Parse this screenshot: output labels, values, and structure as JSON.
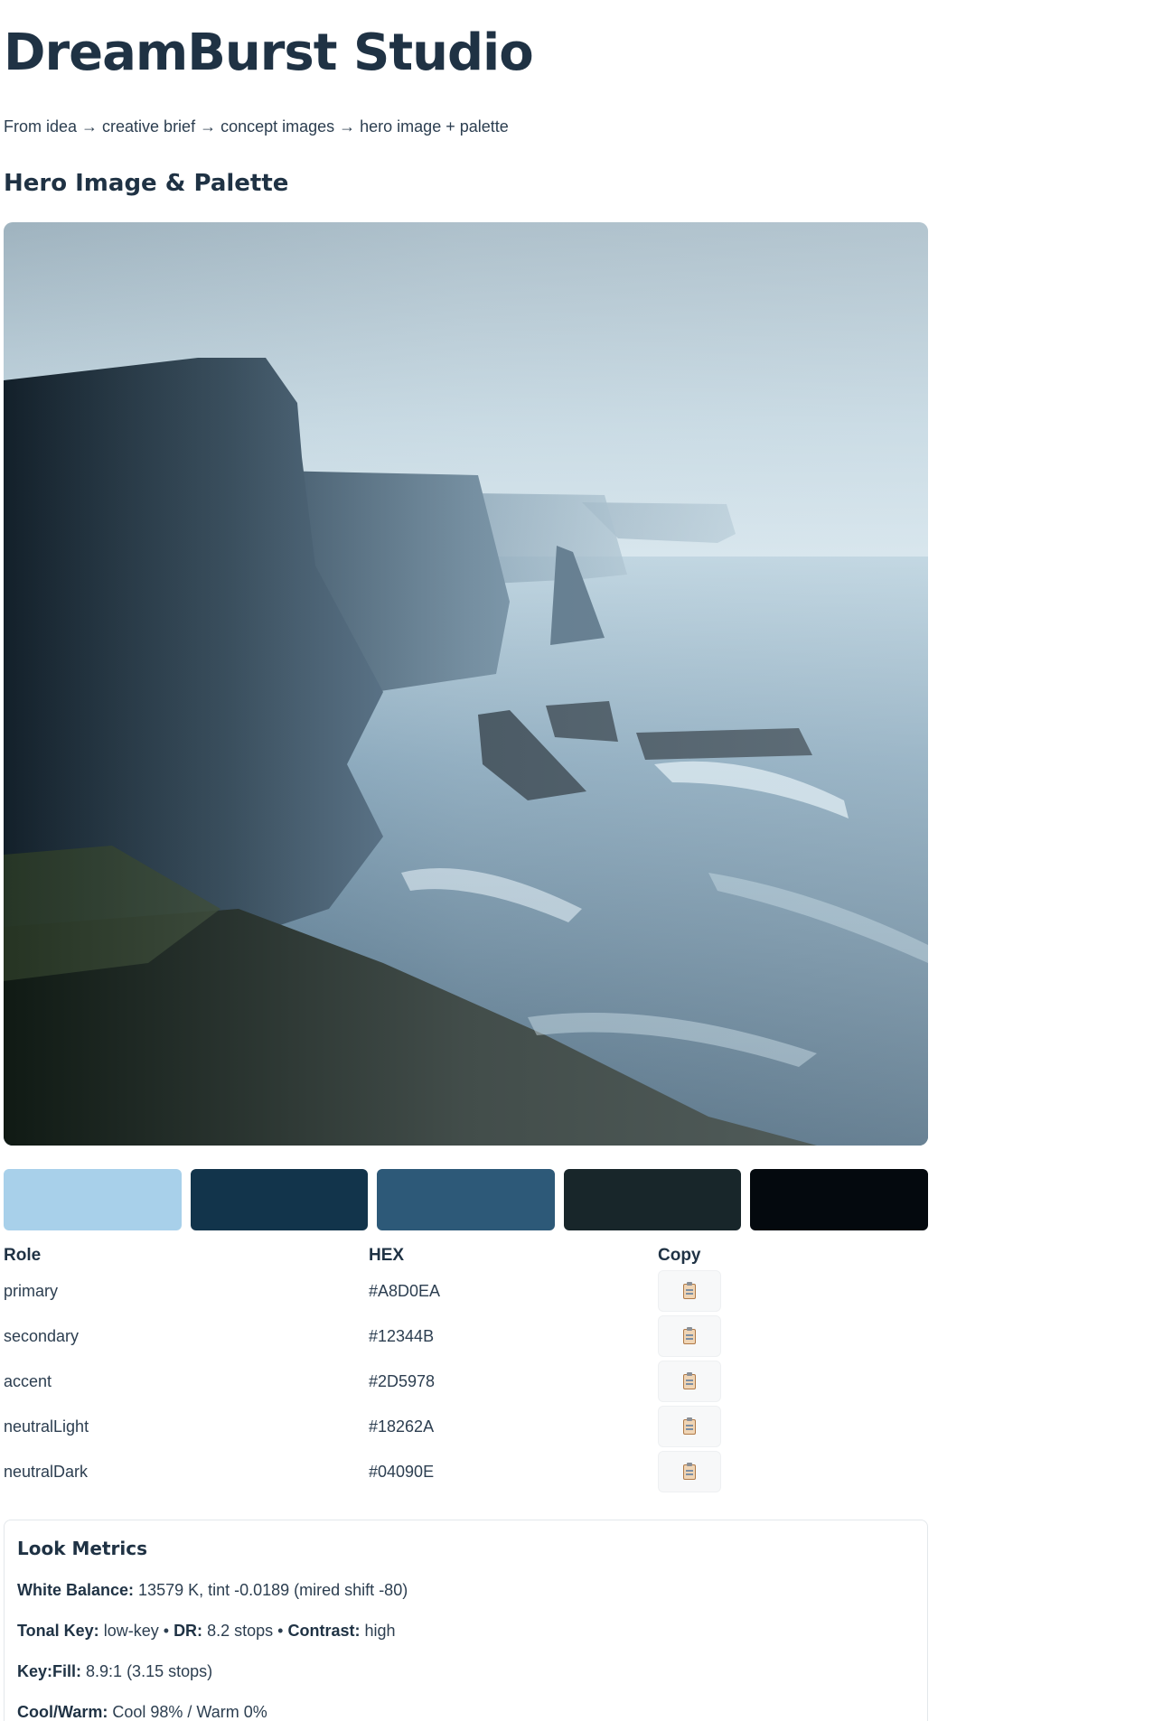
{
  "header": {
    "title": "DreamBurst Studio",
    "subtitle": "From idea → creative brief → concept images → hero image + palette"
  },
  "hero_section": {
    "title": "Hero Image & Palette"
  },
  "palette": {
    "columns": {
      "role": "Role",
      "hex": "HEX",
      "copy": "Copy"
    },
    "rows": [
      {
        "role": "primary",
        "hex": "#A8D0EA",
        "copy_icon": "clipboard-icon"
      },
      {
        "role": "secondary",
        "hex": "#12344B",
        "copy_icon": "clipboard-icon"
      },
      {
        "role": "accent",
        "hex": "#2D5978",
        "copy_icon": "clipboard-icon"
      },
      {
        "role": "neutralLight",
        "hex": "#18262A",
        "copy_icon": "clipboard-icon"
      },
      {
        "role": "neutralDark",
        "hex": "#04090E",
        "copy_icon": "clipboard-icon"
      }
    ]
  },
  "metrics": {
    "title": "Look Metrics",
    "white_balance_label": "White Balance:",
    "white_balance_value": "13579 K,  tint -0.0189 (mired shift -80)",
    "tonal_key_label": "Tonal Key:",
    "tonal_key_value": "low-key",
    "separator": "•",
    "dr_label": "DR:",
    "dr_value": "8.2 stops",
    "contrast_label": "Contrast:",
    "contrast_value": "high",
    "key_fill_label": "Key:Fill:",
    "key_fill_value": "8.9:1 (3.15 stops)",
    "cool_warm_label": "Cool/Warm:",
    "cool_warm_value": "Cool 98% / Warm 0%"
  }
}
